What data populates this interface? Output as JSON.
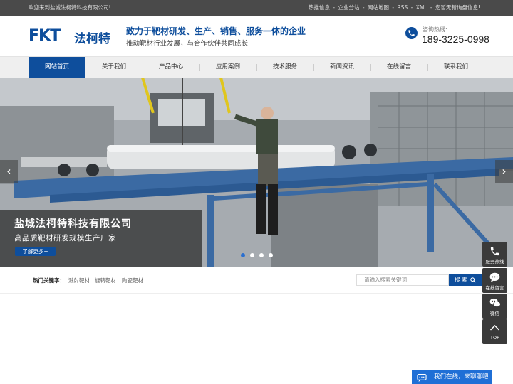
{
  "topbar": {
    "welcome": "欢迎来到盐城法柯特科技有限公司!",
    "links": [
      "热推信息",
      "-",
      "企业分站",
      "-",
      "网站地图",
      "-",
      "RSS",
      "-",
      "XML",
      "-",
      "您暂无新询盘信息!"
    ]
  },
  "header": {
    "logo_mark": "FKT",
    "logo_cn": "法柯特",
    "slogan_main": "致力于靶材研发、生产、销售、服务一体的企业",
    "slogan_sub": "推动靶材行业发展，与合作伙伴共同成长",
    "hotline_label": "咨询热线:",
    "hotline_number": "189-3225-0998",
    "accent_color": "#0e4e9c"
  },
  "nav": {
    "items": [
      "网站首页",
      "关于我们",
      "产品中心",
      "应用案例",
      "技术服务",
      "新闻资讯",
      "在线留言",
      "联系我们"
    ],
    "active_index": 0
  },
  "banner": {
    "title": "盐城法柯特科技有限公司",
    "subtitle": "高品质靶材研发规模生产厂家",
    "button": "了解更多+",
    "prev_arrow": "‹",
    "next_arrow": "›",
    "slide_count": 4,
    "active_slide": 0
  },
  "keywords": {
    "label": "热门关键字：",
    "items": [
      "溅射靶材",
      "旋转靶材",
      "陶瓷靶材"
    ]
  },
  "search": {
    "placeholder": "请输入搜索关键词",
    "button": "搜  索"
  },
  "sidebar": {
    "items": [
      {
        "label": "服务热线",
        "icon": "phone-icon"
      },
      {
        "label": "在线留言",
        "icon": "message-icon"
      },
      {
        "label": "微信",
        "icon": "wechat-icon"
      },
      {
        "label": "TOP",
        "icon": "arrow-up-icon"
      }
    ]
  },
  "chat": {
    "label": "我们在线，来聊聊吧"
  }
}
